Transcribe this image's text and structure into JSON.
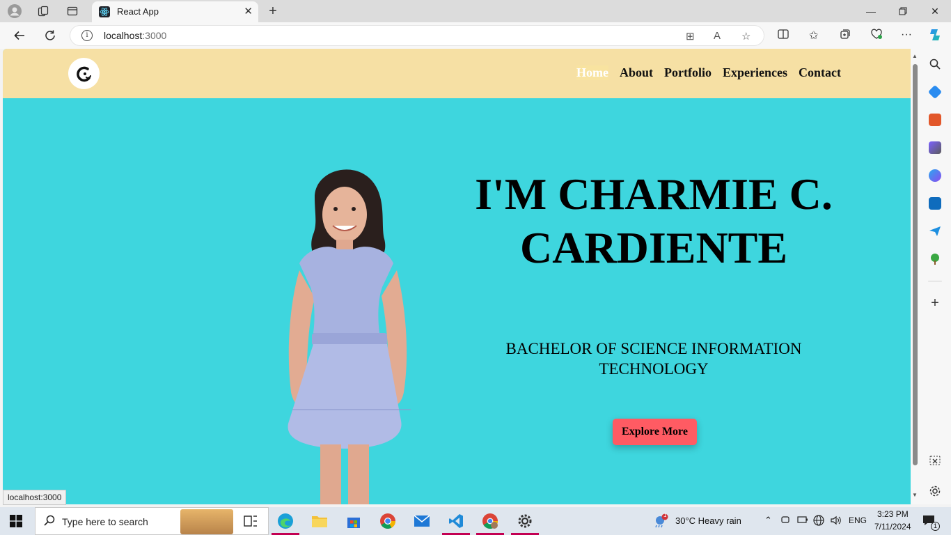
{
  "browser": {
    "tab_title": "React App",
    "url_host": "localhost",
    "url_port": ":3000",
    "status_url": "localhost:3000"
  },
  "site": {
    "nav": [
      "Home",
      "About",
      "Portfolio",
      "Experiences",
      "Contact"
    ],
    "active_nav": "Home",
    "hero_title_line1": "I'M CHARMIE C.",
    "hero_title_line2": "CARDIENTE",
    "hero_subtitle_line1": "BACHELOR OF SCIENCE INFORMATION",
    "hero_subtitle_line2": "TECHNOLOGY",
    "cta_label": "Explore More",
    "colors": {
      "header_bg": "#f6e0a4",
      "hero_bg": "#3ed6de",
      "cta_bg": "#ff5b63"
    }
  },
  "taskbar": {
    "search_placeholder": "Type here to search",
    "weather": "30°C  Heavy rain",
    "weather_badge": "1",
    "language": "ENG",
    "time": "3:23 PM",
    "date": "7/11/2024",
    "notification_count": "1"
  }
}
